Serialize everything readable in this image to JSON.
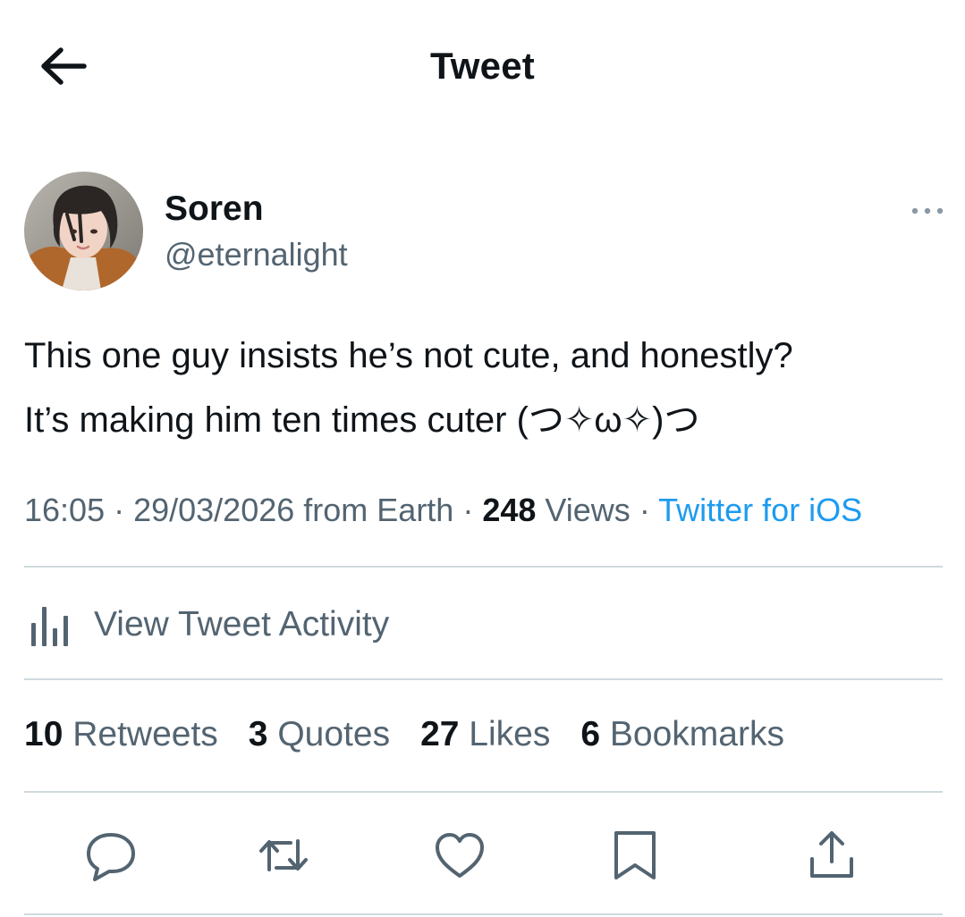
{
  "header": {
    "title": "Tweet",
    "back_icon": "arrow-left-icon"
  },
  "author": {
    "display_name": "Soren",
    "handle": "@eternalight",
    "avatar_icon": "avatar-photo"
  },
  "tweet": {
    "lines": [
      "This one guy insists he’s not cute, and honestly?",
      "It’s making him ten times cuter (つ✧ω✧)つ"
    ]
  },
  "meta": {
    "time": "16:05",
    "sep1": " · ",
    "date": "29/03/2026",
    "location": " from Earth",
    "sep2": " · ",
    "views_count": "248",
    "views_label": " Views",
    "sep3": " · ",
    "source": "Twitter for iOS"
  },
  "activity": {
    "label": "View Tweet Activity"
  },
  "stats": {
    "retweets_count": "10",
    "retweets_label": " Retweets",
    "quotes_count": "3",
    "quotes_label": " Quotes",
    "likes_count": "27",
    "likes_label": " Likes",
    "bookmarks_count": "6",
    "bookmarks_label": " Bookmarks"
  },
  "actions": [
    "reply-icon",
    "retweet-icon",
    "like-icon",
    "bookmark-icon",
    "share-icon"
  ],
  "colors": {
    "text": "#0f1419",
    "secondary": "#536471",
    "link": "#1d9bf0",
    "divider": "#cfd9de"
  }
}
